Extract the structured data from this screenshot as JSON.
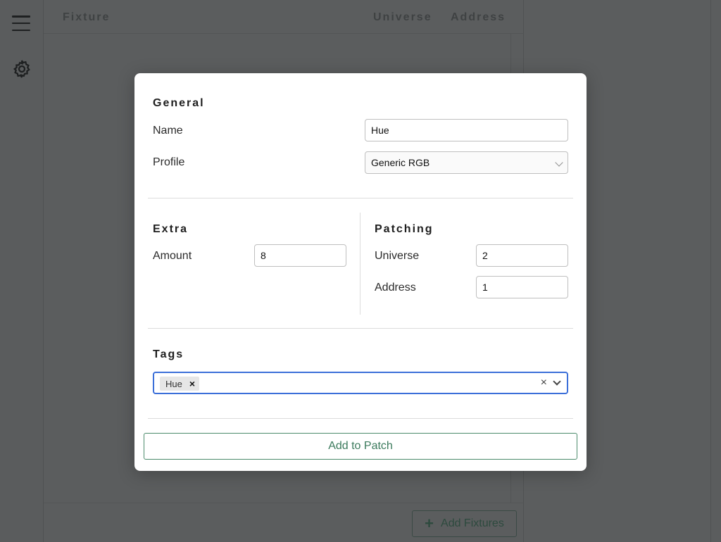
{
  "table": {
    "headers": {
      "fixture": "Fixture",
      "universe": "Universe",
      "address": "Address"
    }
  },
  "footer": {
    "add_fixtures_label": "Add Fixtures"
  },
  "icons": {
    "menu": "hamburger-icon",
    "settings": "gear-icon",
    "add": "plus-icon"
  },
  "colors": {
    "accent": "#3b7a5c",
    "focus": "#3b6fd9",
    "overlay": "#5b5d5e"
  },
  "modal": {
    "general": {
      "title": "General",
      "name_label": "Name",
      "name_value": "Hue",
      "profile_label": "Profile",
      "profile_value": "Generic RGB"
    },
    "extra": {
      "title": "Extra",
      "amount_label": "Amount",
      "amount_value": "8"
    },
    "patching": {
      "title": "Patching",
      "universe_label": "Universe",
      "universe_value": "2",
      "address_label": "Address",
      "address_value": "1"
    },
    "tags": {
      "title": "Tags",
      "selected": [
        "Hue"
      ],
      "chip_remove": "×",
      "clear": "×"
    },
    "submit_label": "Add to Patch"
  }
}
